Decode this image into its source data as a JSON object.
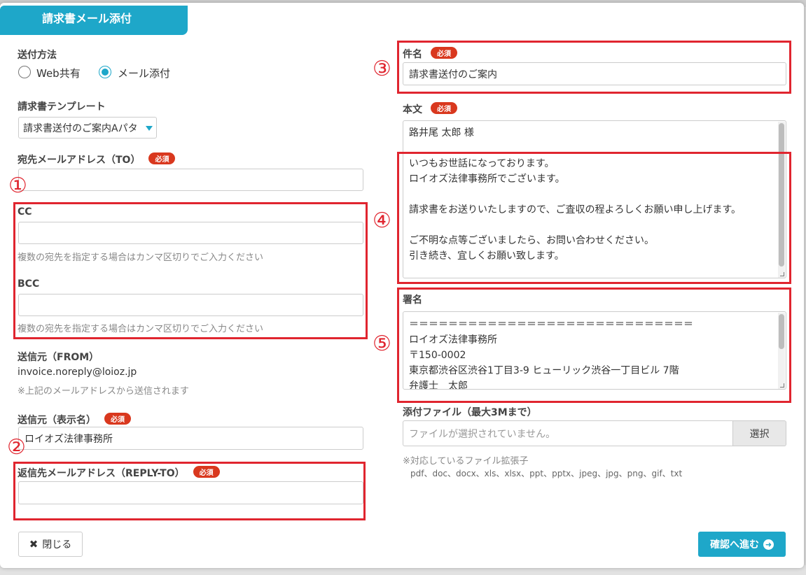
{
  "modal": {
    "title": "請求書メール添付"
  },
  "send_method": {
    "label": "送付方法",
    "options": [
      {
        "label": "Web共有",
        "selected": false
      },
      {
        "label": "メール添付",
        "selected": true
      }
    ]
  },
  "template": {
    "label": "請求書テンプレート",
    "value": "請求書送付のご案内Aパタ"
  },
  "required_badge": "必須",
  "to": {
    "label": "宛先メールアドレス（TO）",
    "value": ""
  },
  "cc": {
    "label": "CC",
    "value": "",
    "hint": "複数の宛先を指定する場合はカンマ区切りでご入力ください"
  },
  "bcc": {
    "label": "BCC",
    "value": "",
    "hint": "複数の宛先を指定する場合はカンマ区切りでご入力ください"
  },
  "from": {
    "label": "送信元（FROM）",
    "value": "invoice.noreply@loioz.jp",
    "hint": "※上記のメールアドレスから送信されます"
  },
  "from_name": {
    "label": "送信元（表示名）",
    "value": "ロイオズ法律事務所"
  },
  "reply_to": {
    "label": "返信先メールアドレス（REPLY-TO）",
    "value": ""
  },
  "subject": {
    "label": "件名",
    "value": "請求書送付のご案内"
  },
  "body": {
    "label": "本文",
    "lines": [
      "路井尾 太郎 様",
      "",
      "いつもお世話になっております。",
      "ロイオズ法律事務所でございます。",
      "",
      "請求書をお送りいたしますので、ご査収の程よろしくお願い申し上げます。",
      "",
      "ご不明な点等ございましたら、お問い合わせください。",
      "引き続き、宜しくお願い致します。"
    ]
  },
  "signature": {
    "label": "署名",
    "lines": [
      "＝＝＝＝＝＝＝＝＝＝＝＝＝＝＝＝＝＝＝＝＝＝＝＝＝＝＝＝＝",
      "ロイオズ法律事務所",
      "〒150-0002",
      "東京都渋谷区渋谷1丁目3-9 ヒューリック渋谷一丁目ビル 7階",
      "弁護士　太郎"
    ]
  },
  "attachment": {
    "label": "添付ファイル（最大3Mまで）",
    "placeholder": "ファイルが選択されていません。",
    "button": "選択",
    "hint": "※対応しているファイル拡張子",
    "extensions": "pdf、doc、docx、xls、xlsx、ppt、pptx、jpeg、jpg、png、gif、txt"
  },
  "annotations": [
    "①",
    "②",
    "③",
    "④",
    "⑤"
  ],
  "footer": {
    "close": "閉じる",
    "confirm": "確認へ進む"
  },
  "colors": {
    "accent": "#1ea7c9",
    "required": "#d9381e",
    "annotation": "#e0252f"
  }
}
